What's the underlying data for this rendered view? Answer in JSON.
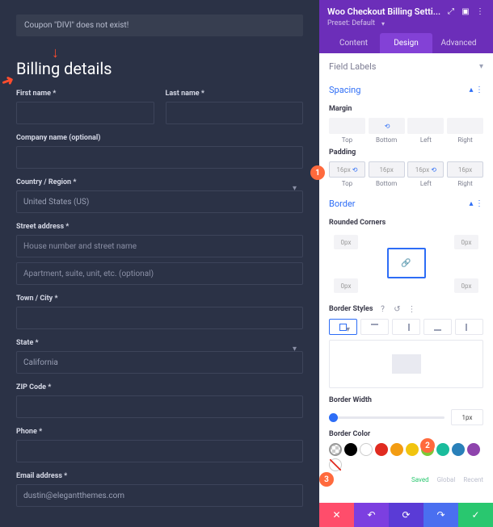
{
  "coupon_msg": "Coupon \"DIVI\" does not exist!",
  "heading": "Billing details",
  "f": {
    "first": "First name *",
    "last": "Last name *",
    "company": "Company name (optional)",
    "country": "Country / Region *",
    "country_v": "United States (US)",
    "street": "Street address *",
    "street_ph": "House number and street name",
    "apt_ph": "Apartment, suite, unit, etc. (optional)",
    "town": "Town / City *",
    "state": "State *",
    "state_v": "California",
    "zip": "ZIP Code *",
    "phone": "Phone *",
    "email": "Email address *",
    "email_v": "dustin@elegantthemes.com"
  },
  "settings_title": "Woo Checkout Billing Setti...",
  "preset": "Preset: Default",
  "tabs": {
    "content": "Content",
    "design": "Design",
    "advanced": "Advanced"
  },
  "sections": {
    "fl": "Field Labels",
    "spacing": "Spacing",
    "border": "Border"
  },
  "margin": "Margin",
  "padding": "Padding",
  "pad": {
    "top": "Top",
    "bottom": "Bottom",
    "left": "Left",
    "right": "Right",
    "val": "16px",
    "lk": "⟲"
  },
  "rc": "Rounded Corners",
  "cv": "0px",
  "bs": "Border Styles",
  "bw": "Border Width",
  "bwv": "1px",
  "bc": "Border Color",
  "ct": {
    "saved": "Saved",
    "global": "Global",
    "recent": "Recent"
  },
  "badge": {
    "1": "1",
    "2": "2",
    "3": "3"
  }
}
